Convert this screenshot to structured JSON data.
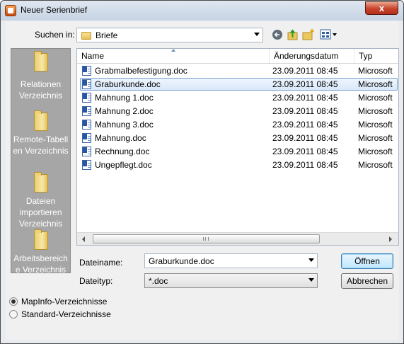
{
  "window": {
    "title": "Neuer Serienbrief",
    "close_label": "x"
  },
  "lookin": {
    "label": "Suchen in:",
    "value": "Briefe"
  },
  "places": [
    {
      "label": "Relationen Verzeichnis"
    },
    {
      "label": "Remote-Tabellen Verzeichnis"
    },
    {
      "label": "Dateien importieren Verzeichnis"
    },
    {
      "label": "Arbeitsbereiche Verzeichnis"
    }
  ],
  "filelist": {
    "headers": {
      "name": "Name",
      "date": "Änderungsdatum",
      "type": "Typ"
    },
    "rows": [
      {
        "name": "Grabmalbefestigung.doc",
        "date": "23.09.2011 08:45",
        "type": "Microsoft"
      },
      {
        "name": "Graburkunde.doc",
        "date": "23.09.2011 08:45",
        "type": "Microsoft"
      },
      {
        "name": "Mahnung 1.doc",
        "date": "23.09.2011 08:45",
        "type": "Microsoft"
      },
      {
        "name": "Mahnung 2.doc",
        "date": "23.09.2011 08:45",
        "type": "Microsoft"
      },
      {
        "name": "Mahnung 3.doc",
        "date": "23.09.2011 08:45",
        "type": "Microsoft"
      },
      {
        "name": "Mahnung.doc",
        "date": "23.09.2011 08:45",
        "type": "Microsoft"
      },
      {
        "name": "Rechnung.doc",
        "date": "23.09.2011 08:45",
        "type": "Microsoft"
      },
      {
        "name": "Ungepflegt.doc",
        "date": "23.09.2011 08:45",
        "type": "Microsoft"
      }
    ],
    "selected_index": 1
  },
  "filename": {
    "label": "Dateiname:",
    "value": "Graburkunde.doc"
  },
  "filetype": {
    "label": "Dateityp:",
    "value": "*.doc"
  },
  "buttons": {
    "open": "Öffnen",
    "cancel": "Abbrechen"
  },
  "options": {
    "mapinfo": "MapInfo-Verzeichnisse",
    "standard": "Standard-Verzeichnisse",
    "selected": "mapinfo"
  },
  "colors": {
    "selection": "#d9e8fa",
    "places_bg": "#a6a6a6",
    "title_bg": "#c6d3e3"
  }
}
